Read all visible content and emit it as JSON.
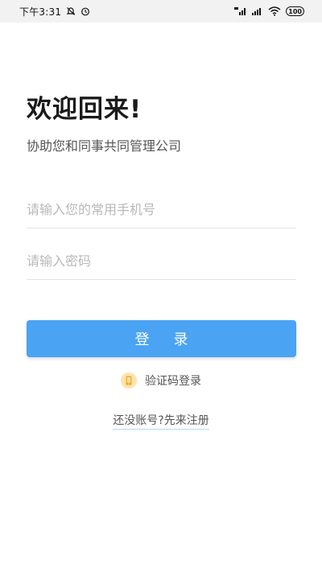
{
  "status_bar": {
    "time": "下午3:31",
    "battery": "100",
    "icons": [
      "notification-muted-icon",
      "alarm-icon",
      "hd-signal-icon",
      "signal-icon",
      "wifi-icon",
      "battery-icon"
    ]
  },
  "welcome": {
    "title": "欢迎回来!",
    "subtitle": "协助您和同事共同管理公司"
  },
  "form": {
    "phone_value": "",
    "phone_placeholder": "请输入您的常用手机号",
    "password_value": "",
    "password_placeholder": "请输入密码",
    "login_label": "登录"
  },
  "alt_login": {
    "code_login_label": "验证码登录",
    "icon": "phone-icon"
  },
  "register": {
    "label": "还没账号?先来注册"
  },
  "colors": {
    "primary": "#4aa3f3",
    "icon_badge": "#fde3b0",
    "icon_fill": "#f5a623"
  }
}
